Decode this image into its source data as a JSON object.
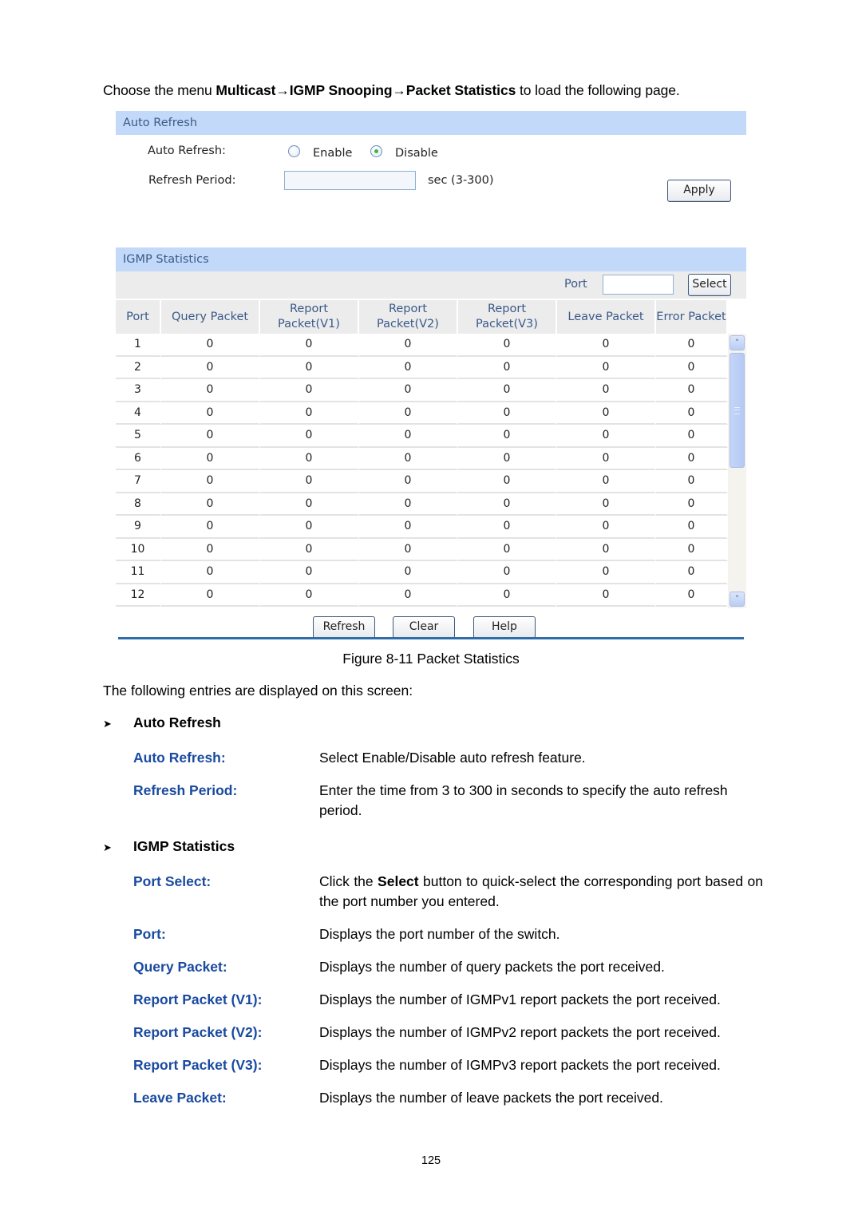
{
  "intro": {
    "prefix": "Choose the menu ",
    "menu_path": "Multicast→IGMP Snooping→Packet Statistics",
    "suffix": " to load the following page."
  },
  "auto_refresh": {
    "section_title": "Auto Refresh",
    "auto_refresh_label": "Auto Refresh:",
    "enable_label": "Enable",
    "disable_label": "Disable",
    "selected": "Disable",
    "refresh_period_label": "Refresh Period:",
    "refresh_period_value": "",
    "refresh_period_hint": "sec (3-300)",
    "apply_label": "Apply"
  },
  "igmp_statistics": {
    "section_title": "IGMP Statistics",
    "port_label": "Port",
    "port_value": "",
    "select_label": "Select",
    "columns": [
      [
        "Port"
      ],
      [
        "Query Packet"
      ],
      [
        "Report",
        "Packet(V1)"
      ],
      [
        "Report",
        "Packet(V2)"
      ],
      [
        "Report",
        "Packet(V3)"
      ],
      [
        "Leave Packet"
      ],
      [
        "Error Packet"
      ]
    ],
    "rows": [
      [
        "1",
        "0",
        "0",
        "0",
        "0",
        "0",
        "0"
      ],
      [
        "2",
        "0",
        "0",
        "0",
        "0",
        "0",
        "0"
      ],
      [
        "3",
        "0",
        "0",
        "0",
        "0",
        "0",
        "0"
      ],
      [
        "4",
        "0",
        "0",
        "0",
        "0",
        "0",
        "0"
      ],
      [
        "5",
        "0",
        "0",
        "0",
        "0",
        "0",
        "0"
      ],
      [
        "6",
        "0",
        "0",
        "0",
        "0",
        "0",
        "0"
      ],
      [
        "7",
        "0",
        "0",
        "0",
        "0",
        "0",
        "0"
      ],
      [
        "8",
        "0",
        "0",
        "0",
        "0",
        "0",
        "0"
      ],
      [
        "9",
        "0",
        "0",
        "0",
        "0",
        "0",
        "0"
      ],
      [
        "10",
        "0",
        "0",
        "0",
        "0",
        "0",
        "0"
      ],
      [
        "11",
        "0",
        "0",
        "0",
        "0",
        "0",
        "0"
      ],
      [
        "12",
        "0",
        "0",
        "0",
        "0",
        "0",
        "0"
      ]
    ],
    "refresh_label": "Refresh",
    "clear_label": "Clear",
    "help_label": "Help"
  },
  "caption": "Figure 8-11 Packet Statistics",
  "entries_intro": "The following entries are displayed on this screen:",
  "sections": [
    {
      "title": "Auto Refresh",
      "entries": [
        {
          "term": "Auto Refresh:",
          "desc": "Select Enable/Disable auto refresh feature."
        },
        {
          "term": "Refresh Period:",
          "desc": "Enter the time from 3 to 300 in seconds to specify the auto refresh period."
        }
      ]
    },
    {
      "title": "IGMP Statistics",
      "entries": [
        {
          "term": "Port Select:",
          "desc_prefix": "Click the ",
          "desc_bold": "Select",
          "desc_suffix": " button to quick-select the corresponding port based on the port number you entered."
        },
        {
          "term": "Port:",
          "desc": "Displays the port number of the switch."
        },
        {
          "term": "Query Packet:",
          "desc": "Displays the number of query packets the port received."
        },
        {
          "term": "Report Packet (V1):",
          "desc": "Displays the number of IGMPv1 report packets the port received."
        },
        {
          "term": "Report Packet (V2):",
          "desc": "Displays the number of IGMPv2 report packets the port received."
        },
        {
          "term": "Report Packet (V3):",
          "desc": "Displays the number of IGMPv3 report packets the port received."
        },
        {
          "term": "Leave Packet:",
          "desc": "Displays the number of leave packets the port received."
        }
      ]
    }
  ],
  "page_number": "125",
  "colors": {
    "section_bar": "#c3d9f9",
    "section_bar_text": "#3a5a88",
    "term_blue": "#1a4aa0",
    "rule_blue": "#2e6ea8"
  }
}
